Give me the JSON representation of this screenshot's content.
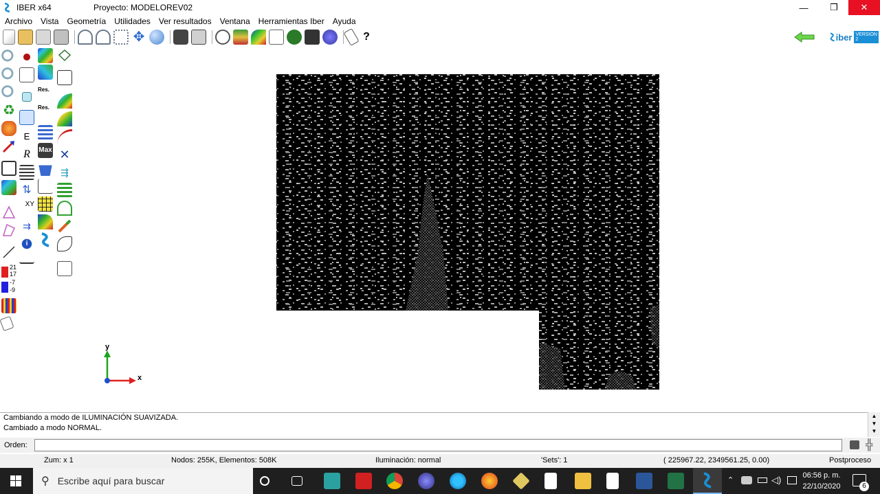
{
  "window": {
    "app_name": "IBER x64",
    "project_title": "Proyecto: MODELOREV02",
    "minimize_glyph": "—",
    "maximize_glyph": "❐",
    "close_glyph": "✕"
  },
  "menu": [
    "Archivo",
    "Vista",
    "Geometría",
    "Utilidades",
    "Ver resultados",
    "Ventana",
    "Herramientas Iber",
    "Ayuda"
  ],
  "brand": {
    "logo_text": "iber",
    "version_text": "VERSION 2"
  },
  "axes": {
    "x_label": "x",
    "y_label": "y"
  },
  "legend_values": [
    "21",
    "17",
    "-7",
    "-9"
  ],
  "palette_labels": {
    "res1": "Res.",
    "res2": "Res.",
    "max": "Max",
    "xy": "XY",
    "r": "R",
    "e": "E"
  },
  "console": {
    "lines": [
      "Cambiando a modo de  ILUMINACIÓN SUAVIZADA.",
      "Cambiado a modo NORMAL."
    ]
  },
  "command": {
    "label": "Orden:",
    "value": ""
  },
  "status": {
    "zoom": "Zum: x 1",
    "nodes": "Nodos: 255K, Elementos: 508K",
    "lighting": "Iluminación: normal",
    "sets": "'Sets': 1",
    "coords": "( 225967.22,  2349561.25,  0.00)",
    "mode": "Postproceso"
  },
  "taskbar": {
    "search_placeholder": "Escribe aquí para buscar",
    "time": "06:56 p. m.",
    "date": "22/10/2020",
    "notification_count": "6"
  },
  "colors": {
    "close_red": "#e81123",
    "mesh_black": "#000000",
    "taskbar": "#1f1f1f",
    "axis_green": "#1aa51a",
    "axis_red": "#e02020"
  }
}
